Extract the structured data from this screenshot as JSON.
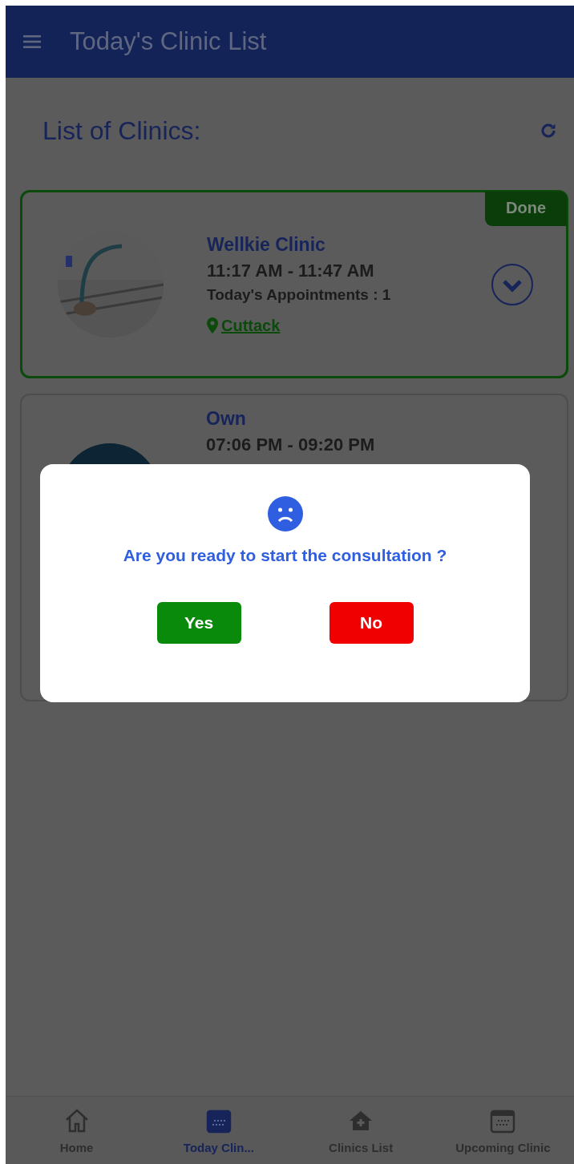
{
  "app_bar": {
    "title": "Today's Clinic List"
  },
  "heading": "List of Clinics:",
  "clinics": [
    {
      "name": "Wellkie Clinic",
      "time": "11:17 AM - 11:47 AM",
      "appointments": "Today's Appointments : 1",
      "location": "Cuttack",
      "done": true,
      "status": "Done"
    },
    {
      "name": "Own",
      "time": "07:06 PM - 09:20 PM",
      "done": false
    }
  ],
  "dialog": {
    "message": "Are you ready to start the consultation ?",
    "buttons": [
      {
        "label": "Yes",
        "kind": "confirm"
      },
      {
        "label": "No",
        "kind": "cancel"
      }
    ]
  },
  "bottom_nav": [
    {
      "label": "Home",
      "selected": false
    },
    {
      "label": "Today Clin...",
      "selected": true
    },
    {
      "label": "Clinics List",
      "selected": false
    },
    {
      "label": "Upcoming Clinic",
      "selected": false
    }
  ]
}
